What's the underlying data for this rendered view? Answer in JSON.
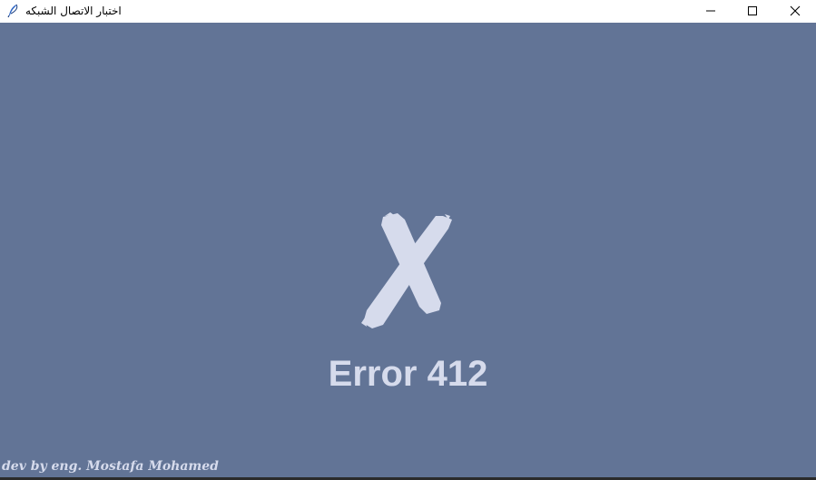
{
  "window": {
    "title": "اختبار الاتصال الشبكه",
    "app_icon": "feather-icon"
  },
  "controls": {
    "minimize_icon": "minimize-icon",
    "maximize_icon": "maximize-icon",
    "close_icon": "close-icon"
  },
  "content": {
    "status_icon": "x-mark-icon",
    "error_message": "Error 412",
    "credit": "dev by eng. Mostafa Mohamed"
  },
  "colors": {
    "background": "#627496",
    "foreground": "#d6dbec",
    "titlebar": "#ffffff"
  }
}
